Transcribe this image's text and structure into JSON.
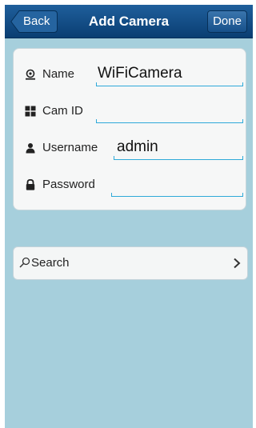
{
  "nav": {
    "title": "Add Camera",
    "back_label": "Back",
    "done_label": "Done",
    "colors": {
      "bar": "#0f4a82",
      "text": "#ffffff"
    }
  },
  "form": {
    "fields": [
      {
        "label": "Name",
        "value": "WiFiCamera",
        "icon": "person-icon"
      },
      {
        "label": "Cam ID",
        "value": "",
        "icon": "grid-icon"
      },
      {
        "label": "Username",
        "value": "admin",
        "icon": "user-icon"
      },
      {
        "label": "Password",
        "value": "",
        "icon": "lock-icon"
      }
    ],
    "colors": {
      "underline": "#2ea9d9"
    }
  },
  "search": {
    "label": "Search",
    "icon": "search-icon",
    "chevron": "chevron-right-icon"
  },
  "colors": {
    "background": "#a6cfdc"
  }
}
